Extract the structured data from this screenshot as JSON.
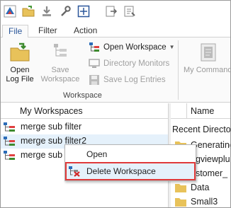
{
  "quick_access": [
    {
      "icon": "app-logo-icon"
    },
    {
      "icon": "open-folder-icon"
    },
    {
      "icon": "download-icon"
    },
    {
      "icon": "wrench-icon"
    },
    {
      "icon": "crosshair-select-icon"
    },
    {
      "icon": "export-icon"
    },
    {
      "icon": "import-icon"
    }
  ],
  "menu_tabs": [
    "File",
    "Filter",
    "Action"
  ],
  "ribbon": {
    "open_log_file": "Open\nLog File",
    "save_workspace": "Save\nWorkspace",
    "open_workspace": "Open Workspace",
    "directory_monitors": "Directory Monitors",
    "save_log_entries": "Save Log Entries",
    "my_commands": "My Commands",
    "group_label": "Workspace"
  },
  "workspaces": {
    "header": "My Workspaces",
    "items": [
      "merge sub filter",
      "merge sub filter2",
      "merge sub filter"
    ]
  },
  "right_pane": {
    "name_header": "Name",
    "recent_title": "Recent Directo",
    "files": [
      "Generating",
      "ogviewplu",
      "ustomer_",
      "Data",
      "Small3"
    ]
  },
  "context_menu": {
    "open": "Open",
    "delete_workspace": "Delete Workspace"
  },
  "colors": {
    "accent": "#2b579a",
    "highlight": "#e5f1fb",
    "callout": "#e03a3a",
    "folder": "#e8c25a"
  }
}
